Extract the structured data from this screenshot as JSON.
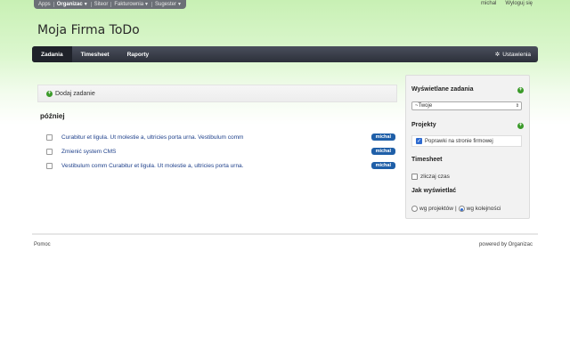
{
  "topbar": {
    "items": [
      "Apps",
      "Organizac",
      "Siteor",
      "Fakturownia",
      "Sugester"
    ]
  },
  "user": {
    "name": "michal",
    "logout": "Wyloguj się"
  },
  "app_title": "Moja Firma ToDo",
  "nav": {
    "tabs": [
      "Zadania",
      "Timesheet",
      "Raporty"
    ],
    "settings": "Ustawienia"
  },
  "main": {
    "add_task": "Dodaj zadanie",
    "group": "później",
    "tasks": [
      {
        "text": "Curabitur et ligula. Ut molestie a, ultricies porta urna. Vestibulum comm",
        "badge": "michal"
      },
      {
        "text": "Zmienić system CMS",
        "badge": "michal"
      },
      {
        "text": "Vestibulum comm Curabitur et ligula. Ut molestie a, ultricies porta urna.",
        "badge": "michal"
      }
    ]
  },
  "panel": {
    "visible_tasks_title": "Wyświetlane zadania",
    "select_value": "~Twoje",
    "projects_title": "Projekty",
    "project_item": "Poprawki na stronie firmowej",
    "timesheet_title": "Timesheet",
    "timesheet_option": "zliczaj czas",
    "display_title": "Jak wyświetlać",
    "radio_projects": "wg projektów",
    "radio_separator": "|",
    "radio_order": "wg kolejności"
  },
  "footer": {
    "help": "Pomoc",
    "powered": "powered by Organizac"
  }
}
